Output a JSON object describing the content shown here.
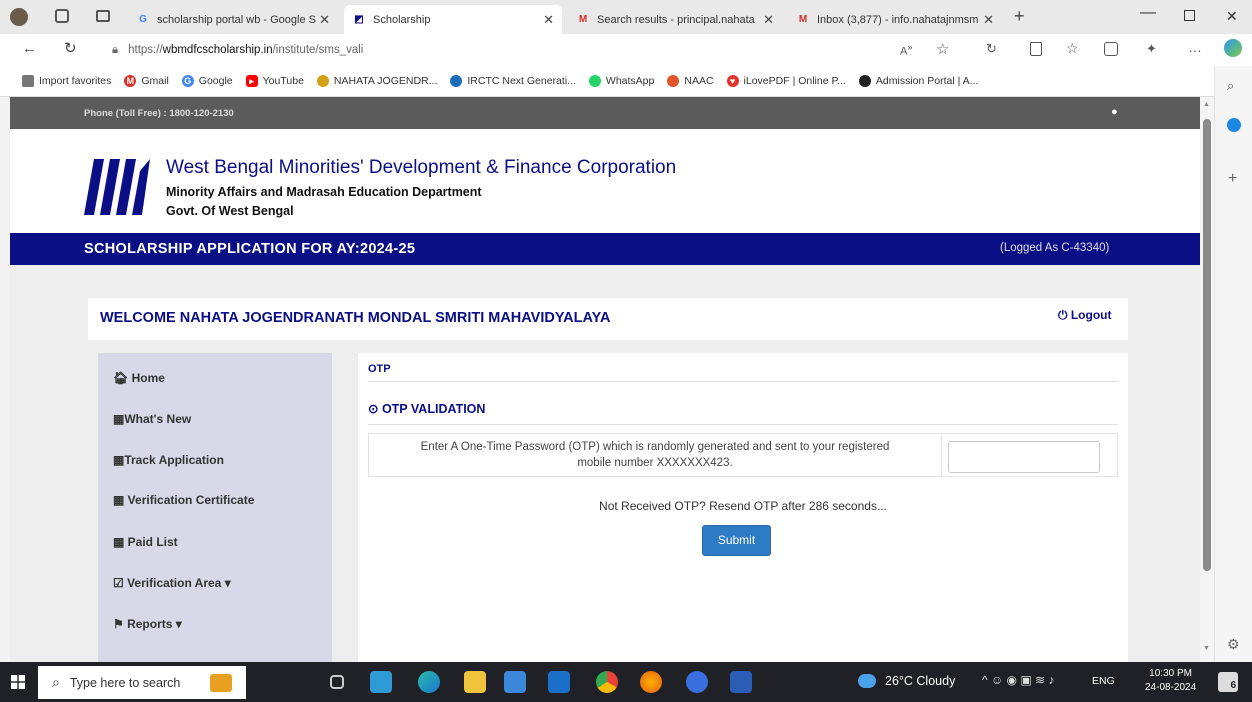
{
  "browser": {
    "tabs": [
      {
        "title": "scholarship portal wb - Google S"
      },
      {
        "title": "Scholarship"
      },
      {
        "title": "Search results - principal.nahata"
      },
      {
        "title": "Inbox (3,877) - info.nahatajnmsm"
      }
    ],
    "url_prefix": "https://",
    "url_domain": "wbmdfcscholarship.in",
    "url_path": "/institute/sms_vali",
    "bookmarks": [
      {
        "label": "Import favorites",
        "icon": "import-icon",
        "color": "#666666"
      },
      {
        "label": "Gmail",
        "icon": "gmail-icon",
        "color": "#d93025"
      },
      {
        "label": "Google",
        "icon": "google-icon",
        "color": "#4285f4"
      },
      {
        "label": "YouTube",
        "icon": "youtube-icon",
        "color": "#ff0000"
      },
      {
        "label": "NAHATA JOGENDR...",
        "icon": "site-icon",
        "color": "#d4a017"
      },
      {
        "label": "IRCTC Next Generati...",
        "icon": "irctc-icon",
        "color": "#1e6fb8"
      },
      {
        "label": "WhatsApp",
        "icon": "whatsapp-icon",
        "color": "#25d366"
      },
      {
        "label": "NAAC",
        "icon": "naac-icon",
        "color": "#e2542b"
      },
      {
        "label": "iLovePDF | Online P...",
        "icon": "ilovepdf-icon",
        "color": "#e5322d"
      },
      {
        "label": "Admission Portal | A...",
        "icon": "portal-icon",
        "color": "#222222"
      }
    ]
  },
  "page": {
    "phone": "Phone (Toll Free) : 1800-120-2130",
    "org_title": "West Bengal Minorities' Development & Finance Corporation",
    "org_sub1": "Minority Affairs and Madrasah Education Department",
    "org_sub2": "Govt. Of West Bengal",
    "banner_title": "SCHOLARSHIP APPLICATION FOR AY:2024-25",
    "logged_as": "(Logged As C-43340)",
    "welcome": "WELCOME NAHATA JOGENDRANATH MONDAL SMRITI MAHAVIDYALAYA",
    "logout": "Logout",
    "nav": [
      {
        "label": "Home",
        "icon": "home-icon"
      },
      {
        "label": "What's New",
        "icon": "list-icon"
      },
      {
        "label": "Track Application",
        "icon": "list-icon"
      },
      {
        "label": "Verification Certificate",
        "icon": "list-icon"
      },
      {
        "label": "Paid List",
        "icon": "list-icon"
      },
      {
        "label": "Verification Area",
        "icon": "check-icon"
      },
      {
        "label": "Reports",
        "icon": "flag-icon"
      }
    ],
    "breadcrumb": "OTP",
    "section_title": "OTP VALIDATION",
    "otp_prompt_line1": "Enter A One-Time Password (OTP) which is randomly generated and sent to your registered",
    "otp_prompt_line2": "mobile number XXXXXXX423.",
    "resend_text": "Not Received OTP? Resend OTP after 286 seconds...",
    "submit_label": "Submit"
  },
  "taskbar": {
    "search_placeholder": "Type here to search",
    "weather": "26°C  Cloudy",
    "lang": "ENG",
    "time": "10:30 PM",
    "date": "24-08-2024",
    "notification_count": "6"
  }
}
